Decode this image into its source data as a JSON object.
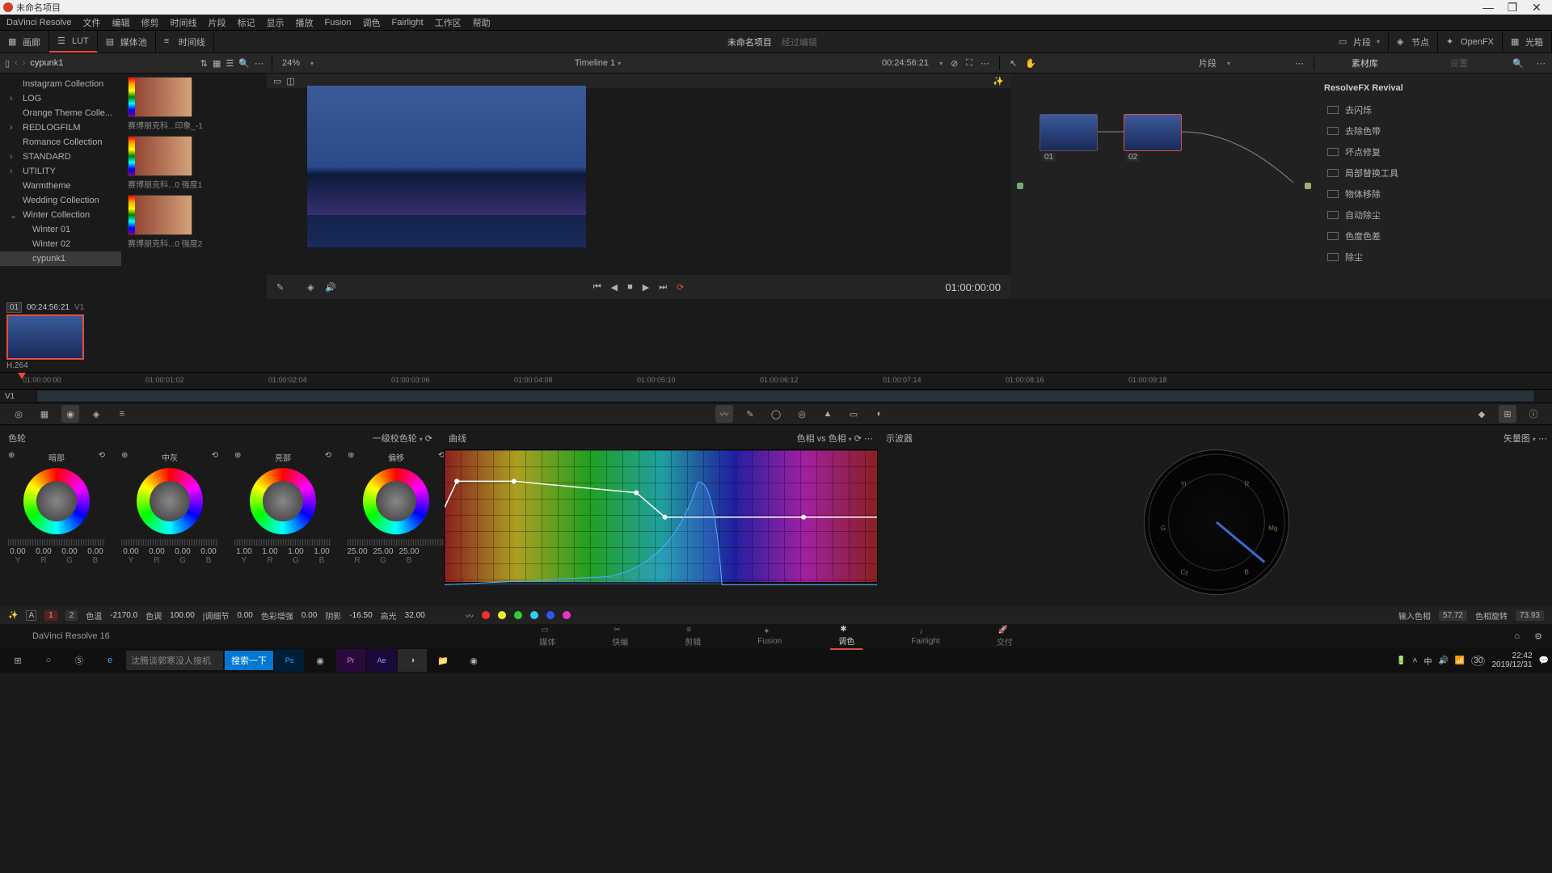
{
  "titlebar": {
    "title": "未命名项目"
  },
  "menu": [
    "DaVinci Resolve",
    "文件",
    "编辑",
    "修剪",
    "时间线",
    "片段",
    "标记",
    "显示",
    "播放",
    "Fusion",
    "调色",
    "Fairlight",
    "工作区",
    "帮助"
  ],
  "tool1": {
    "gallery": "画廊",
    "lut": "LUT",
    "media": "媒体池",
    "timeline": "时间线",
    "project": "未命名项目",
    "modified": "经过编辑",
    "clips": "片段",
    "nodes": "节点",
    "openfx": "OpenFX",
    "lightbox": "光箱"
  },
  "tool2": {
    "crumb": "cypunk1",
    "zoom": "24%",
    "tlname": "Timeline 1",
    "tltc": "00:24:56:21",
    "clips": "片段",
    "lib": "素材库",
    "set": "设置"
  },
  "luts": [
    {
      "label": "Instagram Collection",
      "arrow": false
    },
    {
      "label": "LOG",
      "arrow": true
    },
    {
      "label": "Orange Theme Colle...",
      "arrow": false
    },
    {
      "label": "REDLOGFILM",
      "arrow": true
    },
    {
      "label": "Romance Collection",
      "arrow": false
    },
    {
      "label": "STANDARD",
      "arrow": true
    },
    {
      "label": "UTILITY",
      "arrow": true
    },
    {
      "label": "Warmtheme",
      "arrow": false
    },
    {
      "label": "Wedding Collection",
      "arrow": false
    },
    {
      "label": "Winter Collection",
      "arrow": true,
      "open": true
    },
    {
      "label": "Winter 01",
      "arrow": false,
      "sub": true
    },
    {
      "label": "Winter 02",
      "arrow": false,
      "sub": true
    },
    {
      "label": "cypunk1",
      "arrow": false,
      "sub": true,
      "sel": true
    }
  ],
  "thumbs": [
    {
      "cap": "赛博朋克科...印象_-1"
    },
    {
      "cap": "赛博朋克科...0 强度1"
    },
    {
      "cap": "赛博朋克科...0 强度2"
    }
  ],
  "viewer": {
    "tc": "01:00:00:00"
  },
  "nodes": [
    {
      "id": "01"
    },
    {
      "id": "02"
    }
  ],
  "fx": {
    "header": "ResolveFX Revival",
    "items": [
      "去闪烁",
      "去除色带",
      "坏点修复",
      "局部替换工具",
      "物体移除",
      "自动除尘",
      "色度色差",
      "除尘"
    ]
  },
  "clip": {
    "num": "01",
    "tc": "00:24:56:21",
    "track": "V1",
    "codec": "H.264"
  },
  "ruler": [
    "01:00:00:00",
    "01:00:01:02",
    "01:00:02:04",
    "01:00:03:06",
    "01:00:04:08",
    "01:00:05:10",
    "01:00:06:12",
    "01:00:07:14",
    "01:00:08:16",
    "01:00:09:18"
  ],
  "wheels": {
    "title": "色轮",
    "mode": "一级校色轮",
    "items": [
      {
        "name": "暗部",
        "y": "0.00",
        "r": "0.00",
        "g": "0.00",
        "b": "0.00",
        "labels": [
          "Y",
          "R",
          "G",
          "B"
        ]
      },
      {
        "name": "中灰",
        "y": "0.00",
        "r": "0.00",
        "g": "0.00",
        "b": "0.00",
        "labels": [
          "Y",
          "R",
          "G",
          "B"
        ]
      },
      {
        "name": "亮部",
        "y": "1.00",
        "r": "1.00",
        "g": "1.00",
        "b": "1.00",
        "labels": [
          "Y",
          "R",
          "G",
          "B"
        ]
      },
      {
        "name": "偏移",
        "y": "25.00",
        "r": "25.00",
        "g": "25.00",
        "b": "25.00",
        "labels": [
          "R",
          "G",
          "B"
        ]
      }
    ]
  },
  "curves": {
    "title": "曲线",
    "mode": "色相 vs 色相"
  },
  "scopes": {
    "title": "示波器",
    "mode": "矢量图"
  },
  "bottom": {
    "idx1": "1",
    "idx2": "2",
    "temp_l": "色温",
    "temp_v": "-2170.0",
    "tint_l": "色调",
    "tint_v": "100.00",
    "md_l": "|调细节",
    "md_v": "0.00",
    "boost_l": "色彩增强",
    "boost_v": "0.00",
    "shad_l": "阴影",
    "shad_v": "-16.50",
    "high_l": "高光",
    "high_v": "32.00",
    "inhue_l": "输入色相",
    "inhue_v": "57.72",
    "rot_l": "色相旋转",
    "rot_v": "73.93"
  },
  "pages": [
    "媒体",
    "快编",
    "剪辑",
    "Fusion",
    "调色",
    "Fairlight",
    "交付"
  ],
  "brand": "DaVinci Resolve 16",
  "task": {
    "search_ph": "沈腾谈郭寒没人接机",
    "search_btn": "搜索一下",
    "time": "22:42",
    "date": "2019/12/31"
  }
}
